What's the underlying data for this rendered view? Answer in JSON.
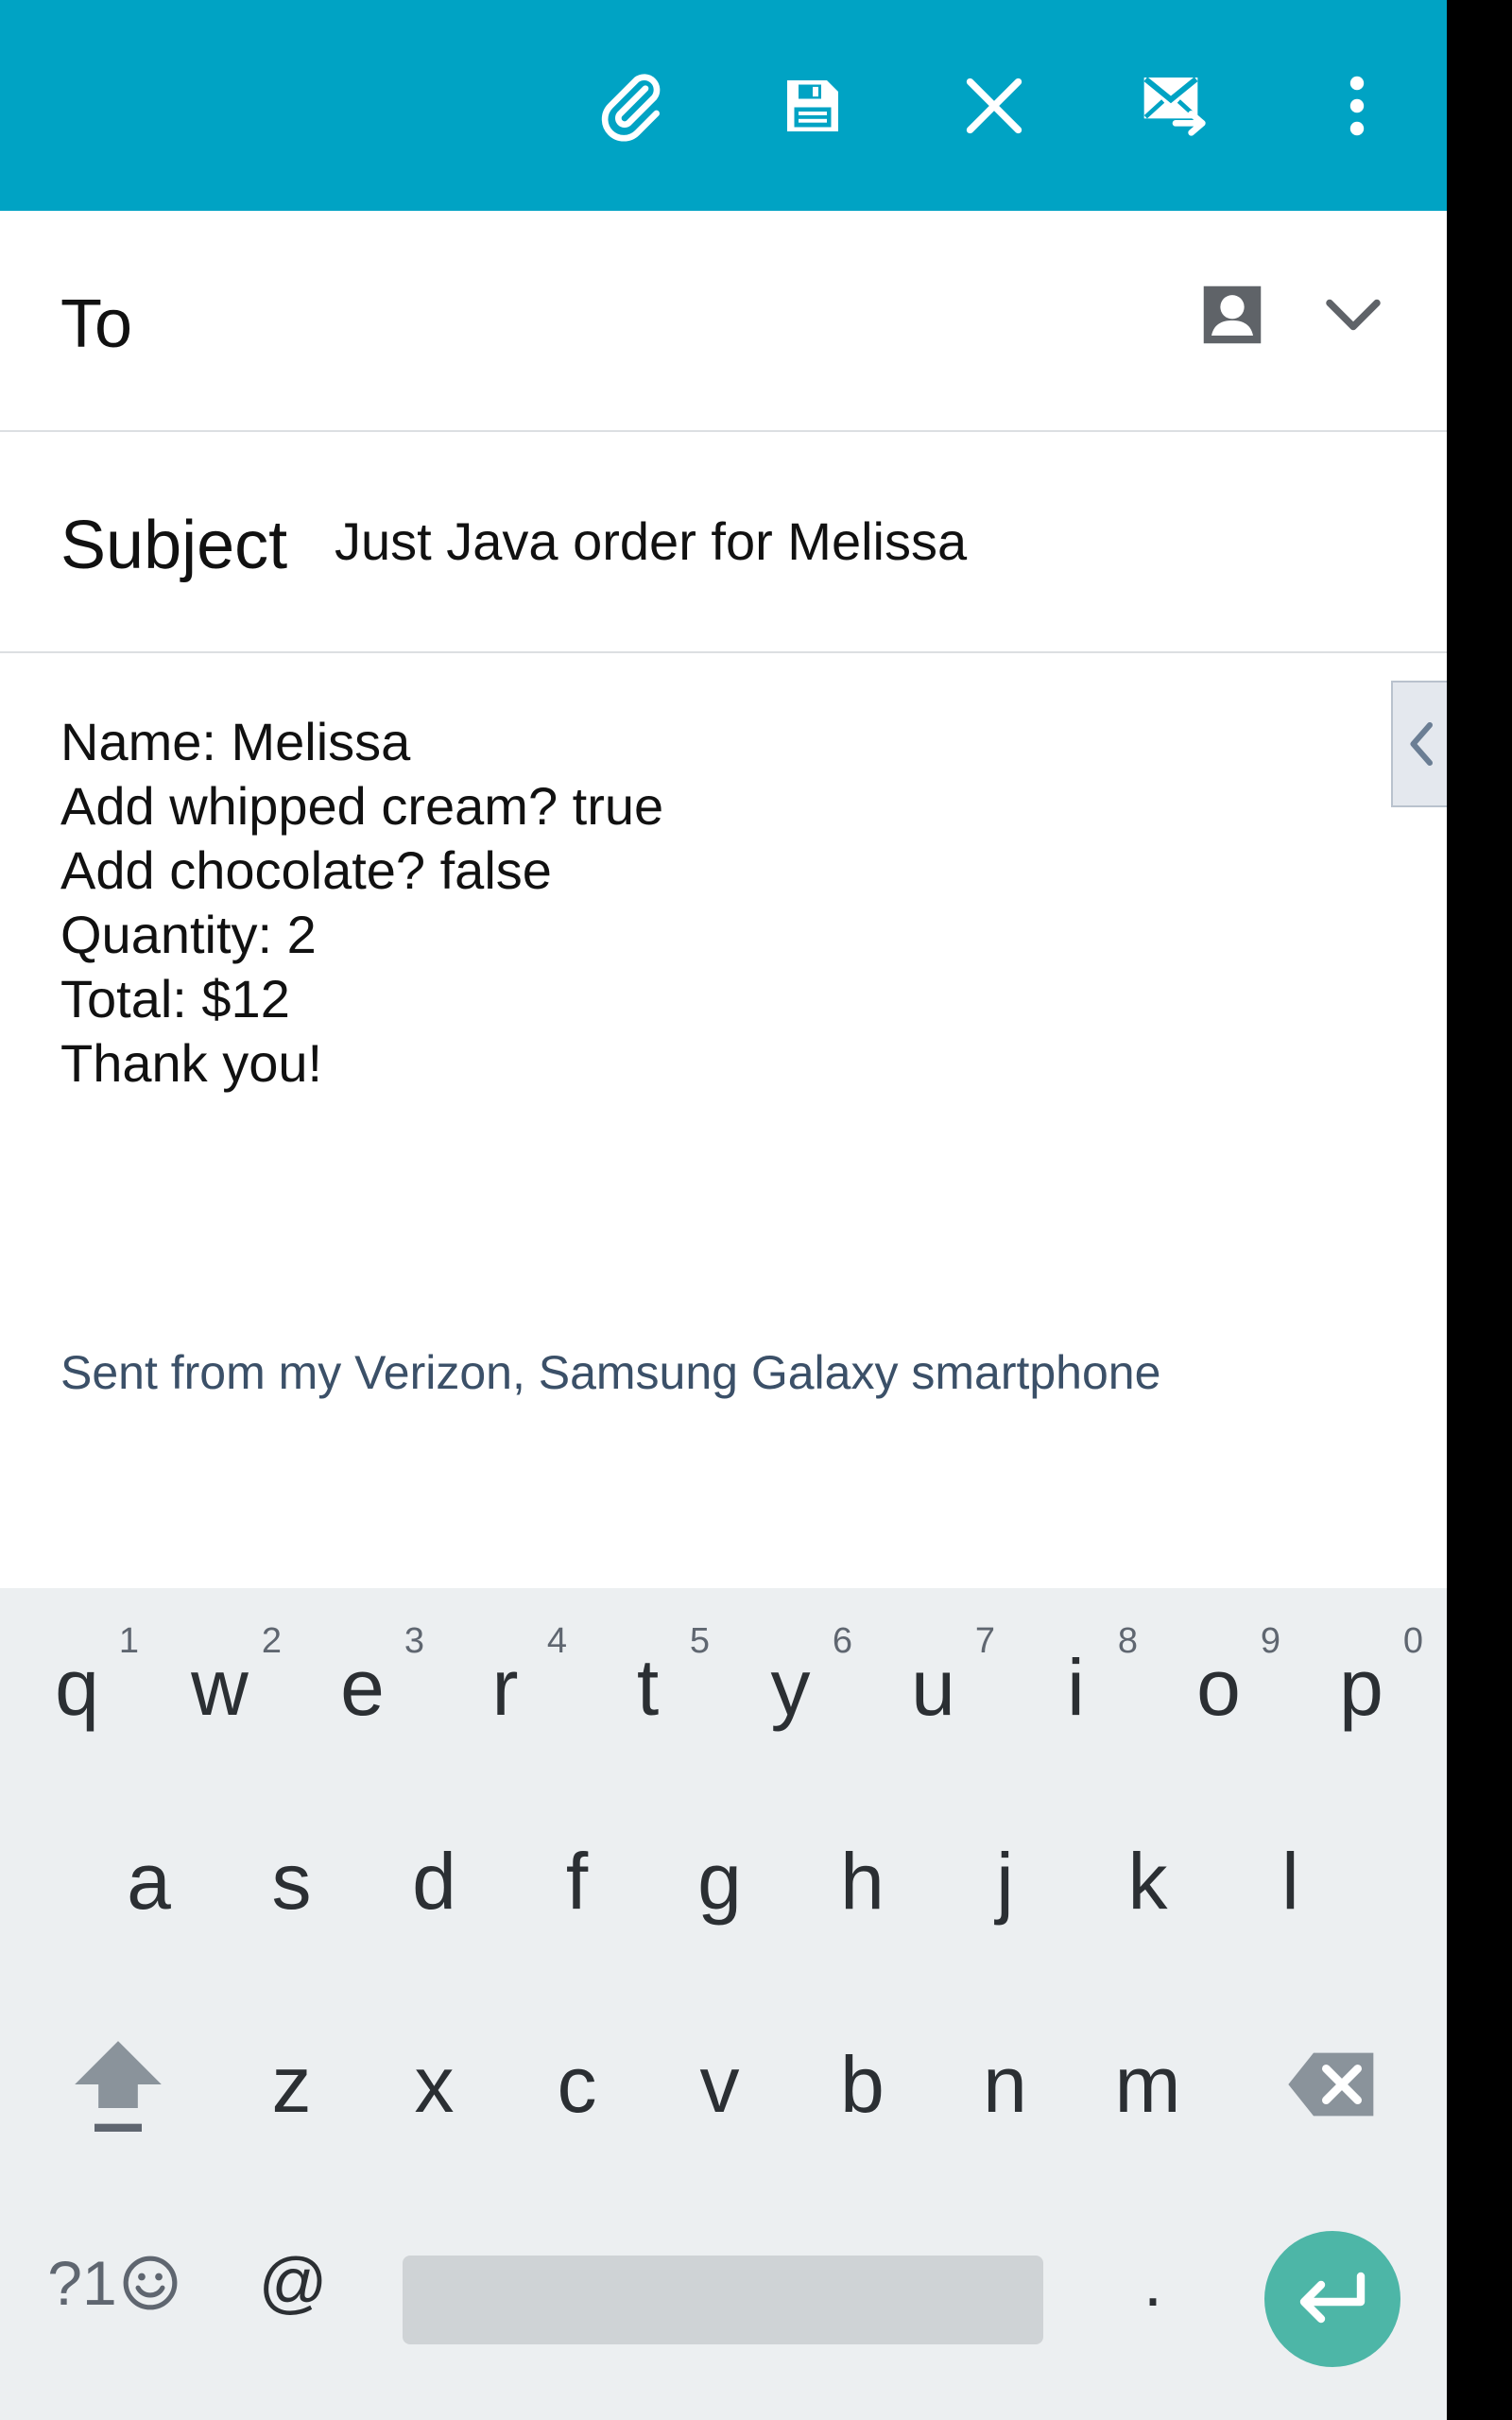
{
  "toolbar": {
    "buttons": [
      {
        "name": "attach",
        "icon": "paperclip-icon"
      },
      {
        "name": "save-draft",
        "icon": "save-icon"
      },
      {
        "name": "discard",
        "icon": "close-icon"
      },
      {
        "name": "send",
        "icon": "send-mail-icon"
      },
      {
        "name": "more",
        "icon": "more-vert-icon"
      }
    ],
    "color": "#00a3c4"
  },
  "compose": {
    "to_label": "To",
    "to_value": "",
    "subject_label": "Subject",
    "subject_value": "Just Java order for Melissa",
    "body_lines": [
      "Name: Melissa",
      "Add whipped cream? true",
      "Add chocolate? false",
      "Quantity: 2",
      "Total: $12",
      "Thank you!"
    ],
    "signature": "Sent from my Verizon, Samsung Galaxy smartphone"
  },
  "keyboard": {
    "row1": [
      {
        "letter": "q",
        "hint": "1"
      },
      {
        "letter": "w",
        "hint": "2"
      },
      {
        "letter": "e",
        "hint": "3"
      },
      {
        "letter": "r",
        "hint": "4"
      },
      {
        "letter": "t",
        "hint": "5"
      },
      {
        "letter": "y",
        "hint": "6"
      },
      {
        "letter": "u",
        "hint": "7"
      },
      {
        "letter": "i",
        "hint": "8"
      },
      {
        "letter": "o",
        "hint": "9"
      },
      {
        "letter": "p",
        "hint": "0"
      }
    ],
    "row2": [
      "a",
      "s",
      "d",
      "f",
      "g",
      "h",
      "j",
      "k",
      "l"
    ],
    "row3": [
      "z",
      "x",
      "c",
      "v",
      "b",
      "n",
      "m"
    ],
    "row4": {
      "symbols_label": "?1",
      "at_label": "@",
      "period_label": "."
    },
    "enter_color": "#4db6a7"
  }
}
